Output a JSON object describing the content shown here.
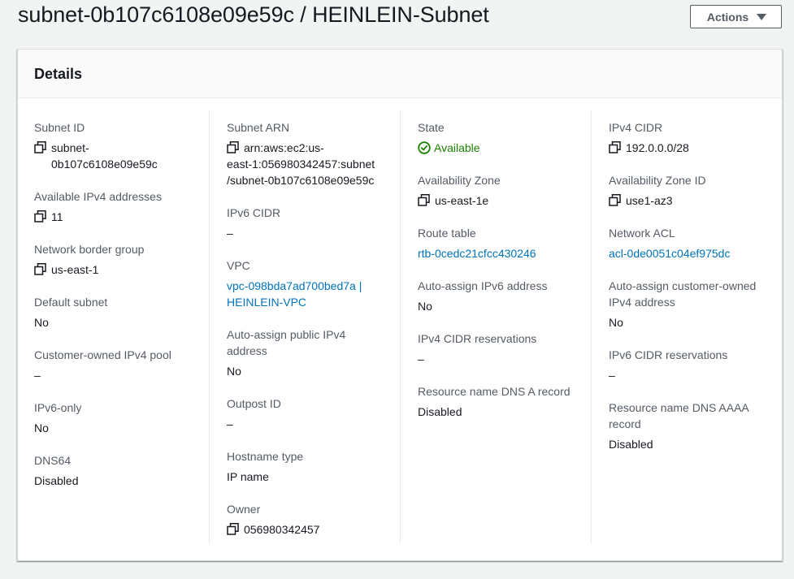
{
  "header": {
    "title": "subnet-0b107c6108e09e59c / HEINLEIN-Subnet",
    "actions_label": "Actions"
  },
  "panel": {
    "title": "Details"
  },
  "col1": {
    "subnet_id_label": "Subnet ID",
    "subnet_id_line1": "subnet-",
    "subnet_id_line2": "0b107c6108e09e59c",
    "avail_ipv4_label": "Available IPv4 addresses",
    "avail_ipv4_value": "11",
    "border_group_label": "Network border group",
    "border_group_value": "us-east-1",
    "default_subnet_label": "Default subnet",
    "default_subnet_value": "No",
    "cust_pool_label": "Customer-owned IPv4 pool",
    "cust_pool_value": "–",
    "ipv6_only_label": "IPv6-only",
    "ipv6_only_value": "No",
    "dns64_label": "DNS64",
    "dns64_value": "Disabled"
  },
  "col2": {
    "arn_label": "Subnet ARN",
    "arn_line1": "arn:aws:ec2:us-",
    "arn_line2": "east-1:056980342457:subnet",
    "arn_line3": "/subnet-0b107c6108e09e59c",
    "ipv6_cidr_label": "IPv6 CIDR",
    "ipv6_cidr_value": "–",
    "vpc_label": "VPC",
    "vpc_line1": "vpc-098bda7ad700bed7a |",
    "vpc_line2": "HEINLEIN-VPC",
    "auto_ipv4_label_1": "Auto-assign public IPv4",
    "auto_ipv4_label_2": "address",
    "auto_ipv4_value": "No",
    "outpost_label": "Outpost ID",
    "outpost_value": "–",
    "hostname_label": "Hostname type",
    "hostname_value": "IP name",
    "owner_label": "Owner",
    "owner_value": "056980342457"
  },
  "col3": {
    "state_label": "State",
    "state_value": "Available",
    "az_label": "Availability Zone",
    "az_value": "us-east-1e",
    "route_label": "Route table",
    "route_value": "rtb-0cedc21cfcc430246",
    "auto_ipv6_label": "Auto-assign IPv6 address",
    "auto_ipv6_value": "No",
    "ipv4_res_label": "IPv4 CIDR reservations",
    "ipv4_res_value": "–",
    "dns_a_label": "Resource name DNS A record",
    "dns_a_value": "Disabled"
  },
  "col4": {
    "ipv4_cidr_label": "IPv4 CIDR",
    "ipv4_cidr_value": "192.0.0.0/28",
    "az_id_label": "Availability Zone ID",
    "az_id_value": "use1-az3",
    "acl_label": "Network ACL",
    "acl_value": "acl-0de0051c04ef975dc",
    "auto_cust_label_1": "Auto-assign customer-owned",
    "auto_cust_label_2": "IPv4 address",
    "auto_cust_value": "No",
    "ipv6_res_label": "IPv6 CIDR reservations",
    "ipv6_res_value": "–",
    "dns_aaaa_label_1": "Resource name DNS AAAA",
    "dns_aaaa_label_2": "record",
    "dns_aaaa_value": "Disabled"
  },
  "colors": {
    "link": "#0073bb",
    "success": "#1d8102",
    "label": "#545b64"
  },
  "icons": [
    "copy-icon",
    "status-available-icon",
    "caret-down-icon"
  ]
}
